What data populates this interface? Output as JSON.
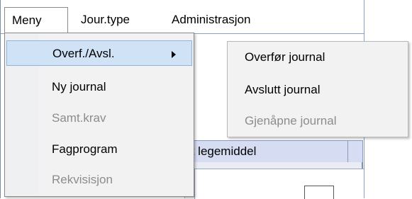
{
  "menubar": {
    "items": [
      {
        "label": "Meny"
      },
      {
        "label": "Jour.type"
      },
      {
        "label": "Administrasjon"
      }
    ]
  },
  "menu_meny": {
    "items": [
      {
        "label": "Overf./Avsl.",
        "enabled": true,
        "submenu": true,
        "highlighted": true
      },
      {
        "label": "Ny journal",
        "enabled": true
      },
      {
        "label": "Samt.krav",
        "enabled": false
      },
      {
        "label": "Fagprogram",
        "enabled": true
      },
      {
        "label": "Rekvisisjon",
        "enabled": false
      }
    ]
  },
  "submenu_overf": {
    "items": [
      {
        "label": "Overfør journal",
        "enabled": true
      },
      {
        "label": "Avslutt journal",
        "enabled": true
      },
      {
        "label": "Gjenåpne journal",
        "enabled": false
      }
    ]
  },
  "background": {
    "tab_label": "tt legemiddel"
  },
  "colors": {
    "highlight": "#cfe2f6",
    "disabled_text": "#8c8c8c",
    "tabstrip": "#d6ddf2"
  }
}
